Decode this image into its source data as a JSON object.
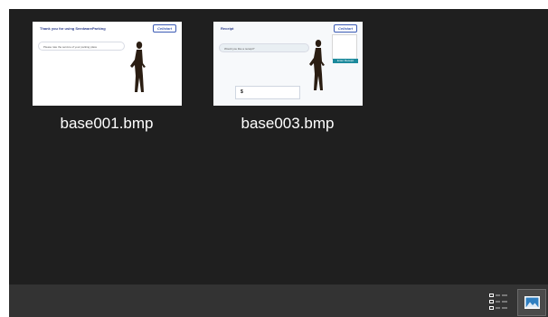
{
  "files": [
    {
      "name": "base001.bmp",
      "thumbnail": {
        "title": "Thank you for using SeedwareParking",
        "logo": "Cellstart",
        "bubble_text": "Please rate the service of your parking place",
        "icon": "image-thumbnail-icon"
      }
    },
    {
      "name": "base003.bmp",
      "thumbnail": {
        "title": "Receipt",
        "logo": "Cellstart",
        "bubble_text": "Would you like a receipt?",
        "button_text": "Enter Receipt",
        "input_value": "$",
        "icon": "image-thumbnail-icon"
      }
    }
  ],
  "status_bar": {
    "details_view_icon": "details-view-icon",
    "large_icons_view_icon": "large-icons-view-icon"
  },
  "colors": {
    "background": "#1f1f1f",
    "status_bar": "#333333",
    "text": "#ffffff",
    "thumb_title": "#2d3e8c",
    "accent_button": "#1c8a9c"
  }
}
